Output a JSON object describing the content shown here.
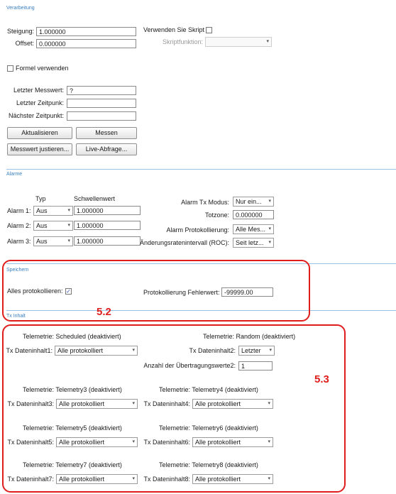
{
  "verarbeitung": {
    "section_title": "Verarbeitung",
    "steigung_label": "Steigung:",
    "steigung_value": "1.000000",
    "offset_label": "Offset:",
    "offset_value": "0.000000",
    "skript_label": "Verwenden Sie Skript",
    "skriptfunktion_label": "Skriptfunktion:",
    "skriptfunktion_value": "",
    "formel_label": "Formel verwenden",
    "letzter_messwert_label": "Letzter Messwert:",
    "letzter_messwert_value": "?",
    "letzter_zeitpunkt_label": "Letzter Zeitpunk:",
    "letzter_zeitpunkt_value": "",
    "naechster_zeitpunkt_label": "Nächster Zeitpunkt:",
    "naechster_zeitpunkt_value": "",
    "aktualisieren_btn": "Aktualisieren",
    "messen_btn": "Messen",
    "justieren_btn": "Messwert justieren...",
    "live_btn": "Live-Abfrage..."
  },
  "alarme": {
    "section_title": "Alarme",
    "typ_header": "Typ",
    "schwellenwert_header": "Schwellenwert",
    "rows": [
      {
        "label": "Alarm 1:",
        "typ": "Aus",
        "wert": "1.000000"
      },
      {
        "label": "Alarm 2:",
        "typ": "Aus",
        "wert": "1.000000"
      },
      {
        "label": "Alarm 3:",
        "typ": "Aus",
        "wert": "1.000000"
      }
    ],
    "tx_modus_label": "Alarm Tx Modus:",
    "tx_modus_value": "Nur ein...",
    "totzone_label": "Totzone:",
    "totzone_value": "0.000000",
    "protokollierung_label": "Alarm Protokollierung:",
    "protokollierung_value": "Alle Mes...",
    "roc_label": "Änderungsratenintervall (ROC):",
    "roc_value": "Seit letz..."
  },
  "speichern": {
    "section_title": "Speichern",
    "alles_label": "Alles protokollieren:",
    "alles_checked": "✓",
    "fehlerwert_label": "Protokollierung Fehlerwert:",
    "fehlerwert_value": "-99999.00"
  },
  "tx_inhalt": {
    "section_title": "Tx Inhalt",
    "telemetrie_label": "Telemetrie:",
    "tel1": "Scheduled (deaktiviert)",
    "tel2": "Random (deaktiviert)",
    "tel3": "Telemetry3 (deaktiviert)",
    "tel4": "Telemetry4 (deaktiviert)",
    "tel5": "Telemetry5 (deaktiviert)",
    "tel6": "Telemetry6 (deaktiviert)",
    "tel7": "Telemetry7 (deaktiviert)",
    "tel8": "Telemetry8 (deaktiviert)",
    "di1_label": "Tx Dateninhalt1:",
    "di2_label": "Tx Dateninhalt2:",
    "di3_label": "Tx Dateninhalt3:",
    "di4_label": "Tx Dateninhalt4:",
    "di5_label": "Tx Dateninhalt5:",
    "di6_label": "Tx Dateninhalt6:",
    "di7_label": "Tx Dateninhalt7:",
    "di8_label": "Tx Dateninhalt8:",
    "di_value": "Alle protokolliert",
    "di2_value": "Letzter",
    "anzahl_label": "Anzahl der Übertragungswerte2:",
    "anzahl_value": "1"
  },
  "annotations": {
    "label_52": "5.2",
    "label_53": "5.3",
    "color": "#e01d1d"
  },
  "colors": {
    "section_title": "#3a7fc1",
    "section_line": "#9cc3e6"
  }
}
